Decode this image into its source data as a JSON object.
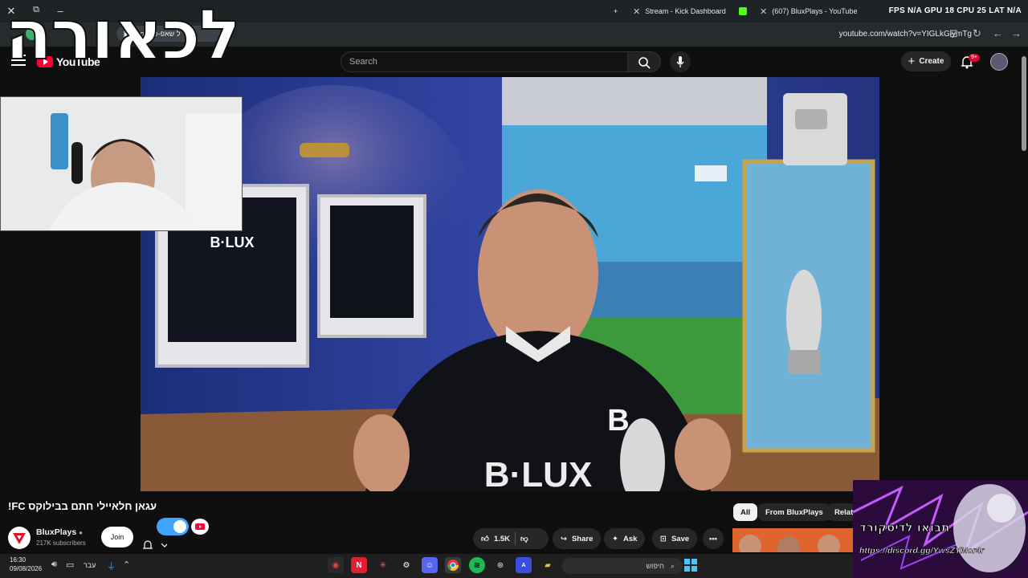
{
  "browser": {
    "tabs": [
      {
        "label": "Stream - Kick Dashboard"
      },
      {
        "label": "(607) BluxPlays - YouTube"
      }
    ],
    "url": "youtube.com/watch?v=YIGLkGiymTg",
    "extension_label": "Google-ל שאפ",
    "window_controls": {
      "close": "✕",
      "restore": "⧉",
      "minimize": "–"
    },
    "new_tab": "+"
  },
  "overlay": {
    "stream_word": "לכאורה",
    "stats": "FPS N/A  GPU 18  CPU 25  LAT N/A"
  },
  "youtube": {
    "logo_text": "YouTube",
    "country_code": "IL",
    "search_placeholder": "Search",
    "create_label": "Create",
    "notification_badge": "9+",
    "video": {
      "title": "עגאן חלאיילי חתם בבילוקס FC!",
      "channel_name": "BluxPlays",
      "subscribers": "217K subscribers",
      "join_label": "Join",
      "likes": "1.5K",
      "share_label": "Share",
      "ask_label": "Ask",
      "save_label": "Save",
      "shirt_text": "B·LUX",
      "logo_mark": "B"
    },
    "chips": [
      "All",
      "From BluxPlays",
      "Relat"
    ]
  },
  "webcam": {
    "label": "webcam feed"
  },
  "discord_banner": {
    "text": "תבואו לדיסקורד",
    "link": "https://discord.gg/YwsZYMor4r"
  },
  "taskbar": {
    "time": "16:30",
    "date": "09/08/2026",
    "language": "עבר",
    "search_placeholder": "חיפוש",
    "apps": [
      "N",
      "A"
    ]
  },
  "colors": {
    "youtube_red": "#ff0033",
    "toggle_blue": "#3ea6ff",
    "background": "#0f0f0f",
    "discord_purple": "#7a2bb8"
  }
}
